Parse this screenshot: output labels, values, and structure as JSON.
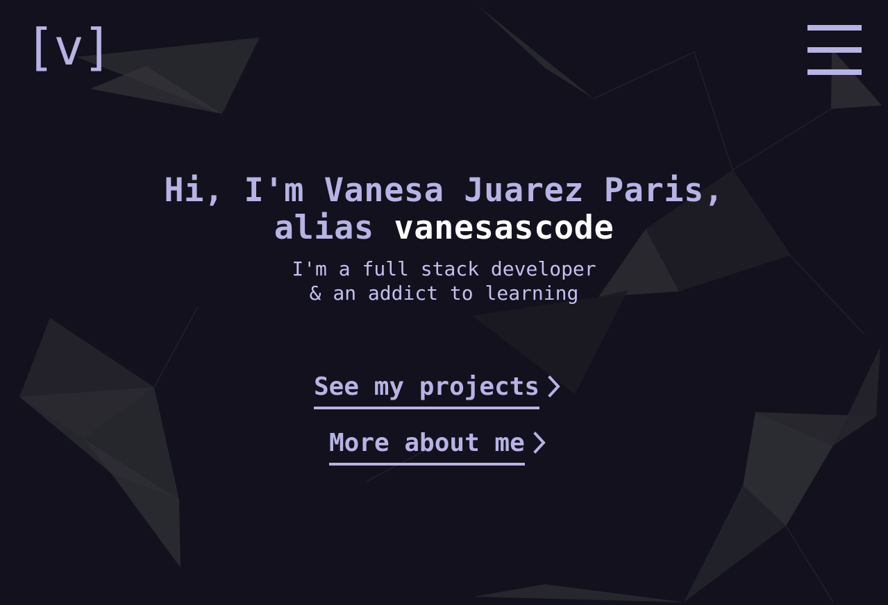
{
  "logo": {
    "text": "[v]"
  },
  "menu": {
    "icon": "hamburger-icon"
  },
  "hero": {
    "line1": "Hi, I'm Vanesa Juarez Paris,",
    "line2_prefix": "alias ",
    "line2_name": "vanesascode",
    "subtitle_line1": "I'm a full stack developer",
    "subtitle_line2": "& an addict to learning"
  },
  "actions": {
    "projects_label": "See my projects",
    "about_label": "More about me",
    "chevron_icon": "chevron-right-icon"
  },
  "colors": {
    "background": "#12111d",
    "accent": "#b7b3e4",
    "highlight": "#ffffff",
    "shape": "#2a2a30"
  }
}
